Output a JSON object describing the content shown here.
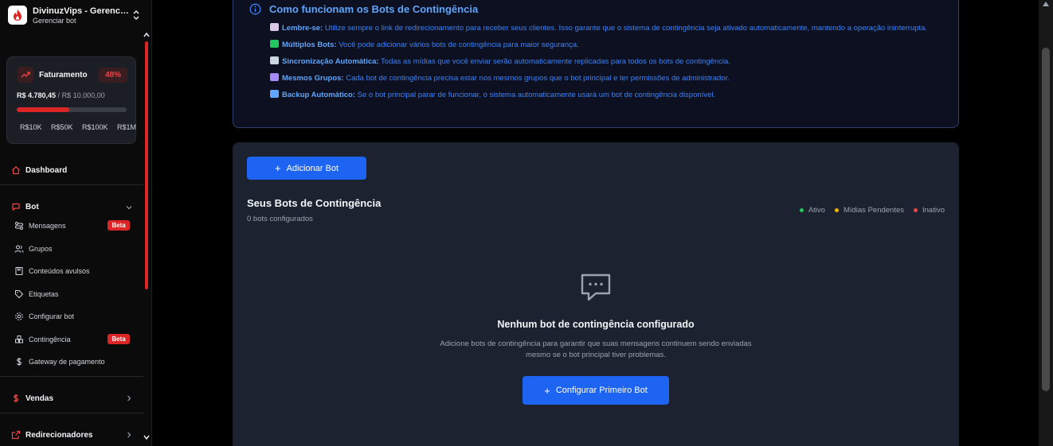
{
  "sidebar": {
    "brand": {
      "title": "DivinuzVips - Gerenciar bot",
      "subtitle": "Gerenciar bot"
    },
    "revenue": {
      "title": "Faturamento",
      "percent": "48%",
      "current": "R$ 4.780,45",
      "separator": " / ",
      "goal": "R$ 10.000,00",
      "progress_fraction": 0.48,
      "milestones": [
        "R$10K",
        "R$50K",
        "R$100K",
        "R$1M"
      ]
    },
    "dashboard": "Dashboard",
    "bot_section": {
      "label": "Bot",
      "items": [
        {
          "label": "Mensagens",
          "badge": "Beta"
        },
        {
          "label": "Grupos"
        },
        {
          "label": "Conteúdos avulsos"
        },
        {
          "label": "Etiquetas"
        },
        {
          "label": "Configurar bot"
        },
        {
          "label": "Contingência",
          "badge": "Beta"
        },
        {
          "label": "Gateway de pagamento"
        }
      ]
    },
    "vendas": "Vendas",
    "redirecionadores": "Redirecionadores"
  },
  "info": {
    "title": "Como funcionam os Bots de Contingência",
    "items": [
      {
        "bold": "Lembre-se:",
        "text": " Utilize sempre o link de redirecionamento para receber seus clientes. Isso garante que o sistema de contingência seja ativado automaticamente, mantendo a operação ininterrupta.",
        "emoji_color": "#d9c7e8"
      },
      {
        "bold": "Múltiplos Bots:",
        "text": " Você pode adicionar vários bots de contingência para maior segurança.",
        "emoji_color": "#22c55e"
      },
      {
        "bold": "Sincronização Automática:",
        "text": " Todas as mídias que você enviar serão automaticamente replicadas para todos os bots de contingência.",
        "emoji_color": "#cbd5e1"
      },
      {
        "bold": "Mesmos Grupos:",
        "text": " Cada bot de contingência precisa estar nos mesmos grupos que o bot principal e ter permissões de administrador.",
        "emoji_color": "#a78bfa"
      },
      {
        "bold": "Backup Automático:",
        "text": " Se o bot principal parar de funcionar, o sistema automaticamente usará um bot de contingência disponível.",
        "emoji_color": "#60a5fa"
      }
    ]
  },
  "panel": {
    "add_button": "Adicionar Bot",
    "title": "Seus Bots de Contingência",
    "subtitle": "0 bots configurados",
    "legend": [
      {
        "label": "Ativo",
        "color": "#22c55e"
      },
      {
        "label": "Mídias Pendentes",
        "color": "#eab308"
      },
      {
        "label": "Inativo",
        "color": "#ef4444"
      }
    ],
    "empty_title": "Nenhum bot de contingência configurado",
    "empty_desc": "Adicione bots de contingência para garantir que suas mensagens continuem sendo enviadas mesmo se o bot principal tiver problemas.",
    "config_button": "Configurar Primeiro Bot"
  },
  "colors": {
    "accent": "#1d64f2",
    "danger": "#dc2626",
    "info": "#3b82f6"
  }
}
